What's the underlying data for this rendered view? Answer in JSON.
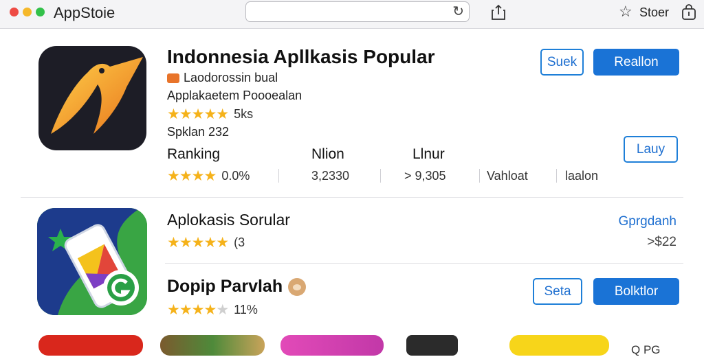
{
  "toolbar": {
    "app_title": "AppStoie",
    "search_value": "",
    "store_label": "Stoer"
  },
  "featured": {
    "title": "Indonnesia Apllkasis Popular",
    "developer": "Laodorossin bual",
    "subtitle": "Applakaetem Poooealan",
    "rating_count": "5ks",
    "extra": "Spklan  232",
    "buttons": {
      "secondary": "Suek",
      "primary": "Reallon",
      "tertiary": "Lauy"
    },
    "stats": [
      {
        "label": "Ranking",
        "value": "0.0%"
      },
      {
        "label": "Nlion",
        "value": "3,2330"
      },
      {
        "label": "Llnur",
        "value": "> 9,305"
      },
      {
        "label": "",
        "value": "Vahloat"
      },
      {
        "label": "",
        "value": "laalon"
      }
    ]
  },
  "list": [
    {
      "title": "Aplokasis Sorular",
      "rating_text": "(3",
      "link": "Gprgdanh",
      "price": ">$22"
    },
    {
      "title": "Dopip Parvlah",
      "rating_text": "11%",
      "buttons": {
        "secondary": "Seta",
        "primary": "Bolktlor"
      }
    }
  ],
  "bottom": {
    "more_label": "Q  PG"
  },
  "colors": {
    "accent": "#1a73d6",
    "star": "#f5b21a"
  }
}
